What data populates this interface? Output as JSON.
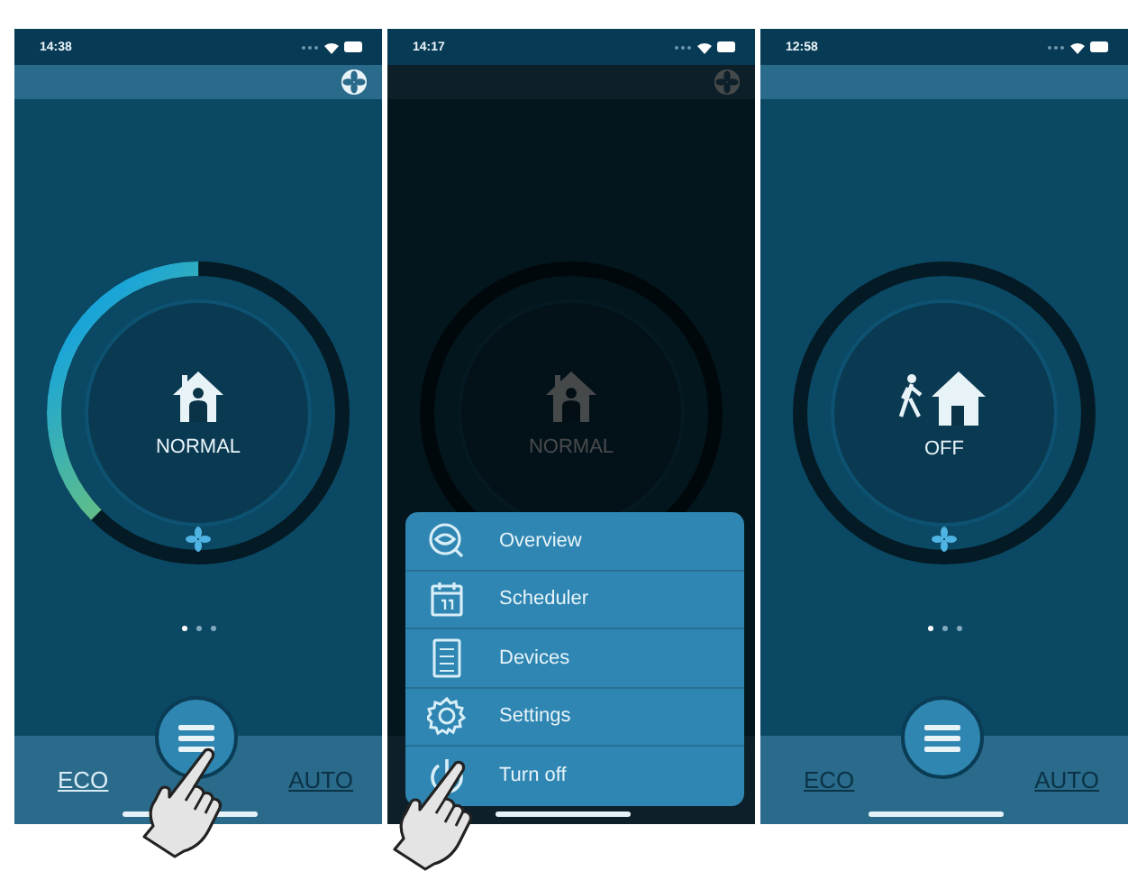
{
  "screens": [
    {
      "status_time": "14:38",
      "dimmed": false,
      "mode": "NORMAL",
      "kind": "home",
      "level": 0.375,
      "gear": true,
      "dots": [
        {
          "selected": true
        },
        {
          "selected": false
        },
        {
          "selected": false
        }
      ],
      "eco": {
        "label": "ECO",
        "selected": true
      },
      "auto": {
        "label": "AUTO",
        "selected": false
      },
      "tap": true
    },
    {
      "status_time": "14:17",
      "dimmed": true,
      "mode": "NORMAL",
      "kind": "home",
      "level": 0,
      "gear": true,
      "menu": [
        {
          "label": "Overview",
          "kind": "overview"
        },
        {
          "label": "Scheduler",
          "kind": "calendar"
        },
        {
          "label": "Devices",
          "kind": "list"
        },
        {
          "label": "Settings",
          "kind": "gear"
        },
        {
          "label": "Turn off",
          "kind": "power"
        }
      ],
      "tap": true
    },
    {
      "status_time": "12:58",
      "dimmed": false,
      "mode": "OFF",
      "kind": "away",
      "level": 0,
      "gear": false,
      "dots": [
        {
          "selected": true
        },
        {
          "selected": false
        },
        {
          "selected": false
        }
      ],
      "eco": {
        "label": "ECO",
        "selected": false
      },
      "auto": {
        "label": "AUTO",
        "selected": false
      },
      "tap": false
    }
  ]
}
